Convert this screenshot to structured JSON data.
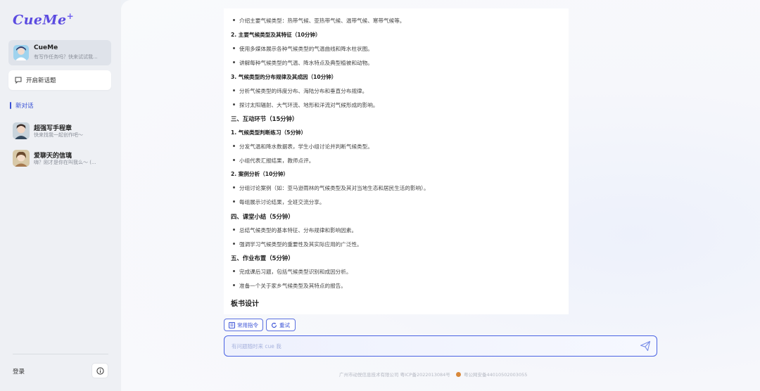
{
  "sidebar": {
    "logo": "CueMe",
    "logo_plus": "+",
    "cueme_card": {
      "title": "CueMe",
      "subtitle": "有写作任务吗？快来试试我..."
    },
    "new_topic": "开启新话题",
    "new_chat": "新对话",
    "chats": [
      {
        "title": "超强写手程章",
        "subtitle": "快来找我一起创作吧～"
      },
      {
        "title": "爱聊天的信璃",
        "subtitle": "嗨？刚才是你在叫我么～ (..."
      }
    ],
    "login": "登录"
  },
  "content": {
    "lines": [
      {
        "type": "bullet",
        "text": "介绍主要气候类型：热带气候、亚热带气候、温带气候、寒带气候等。"
      },
      {
        "type": "sub",
        "text": "2. 主要气候类型及其特征（10分钟）"
      },
      {
        "type": "bullet",
        "text": "使用多媒体展示各种气候类型的气温曲线和降水柱状图。"
      },
      {
        "type": "bullet",
        "text": "讲解每种气候类型的气温、降水特点及典型植被和动物。"
      },
      {
        "type": "sub",
        "text": "3. 气候类型的分布规律及其成因（10分钟）"
      },
      {
        "type": "bullet",
        "text": "分析气候类型的纬度分布、海陆分布和垂直分布规律。"
      },
      {
        "type": "bullet",
        "text": "探讨太阳辐射、大气环流、地形和洋流对气候形成的影响。"
      },
      {
        "type": "section",
        "text": "三、互动环节（15分钟）"
      },
      {
        "type": "sub",
        "text": "1. 气候类型判断练习（5分钟）"
      },
      {
        "type": "bullet",
        "text": "分发气温和降水数据表，学生小组讨论并判断气候类型。"
      },
      {
        "type": "bullet",
        "text": "小组代表汇报结果，教师点评。"
      },
      {
        "type": "sub",
        "text": "2. 案例分析（10分钟）"
      },
      {
        "type": "bullet",
        "text": "分组讨论案例（如：亚马逊雨林的气候类型及其对当地生态和居民生活的影响）。"
      },
      {
        "type": "bullet",
        "text": "每组展示讨论结果，全班交流分享。"
      },
      {
        "type": "section",
        "text": "四、课堂小结（5分钟）"
      },
      {
        "type": "bullet",
        "text": "总结气候类型的基本特征、分布规律和影响因素。"
      },
      {
        "type": "bullet",
        "text": "强调学习气候类型的重要性及其实际应用的广泛性。"
      },
      {
        "type": "section",
        "text": "五、作业布置（5分钟）"
      },
      {
        "type": "bullet",
        "text": "完成课后习题，包括气候类型识别和成因分析。"
      },
      {
        "type": "bullet",
        "text": "准备一个关于家乡气候类型及其特点的报告。"
      },
      {
        "type": "heading",
        "text": "板书设计"
      }
    ]
  },
  "actions": {
    "commands": "常用指令",
    "retry": "重试"
  },
  "input": {
    "placeholder": "有问题随时来 cue 我",
    "value": ""
  },
  "footer": {
    "company": "广州市动悦信息技术有限公司 粤ICP备2022013084号",
    "police": "粤公网安备44010502003055"
  },
  "colors": {
    "accent": "#4a63e3",
    "logo": "#5b4be0"
  }
}
